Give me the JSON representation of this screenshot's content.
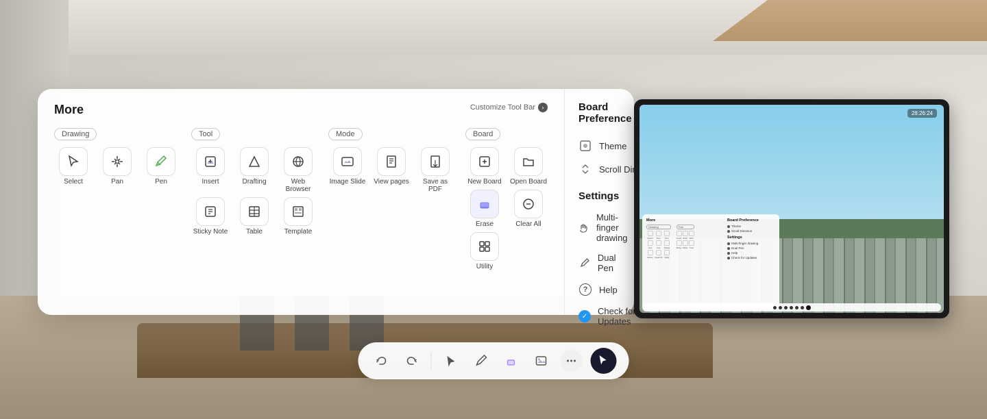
{
  "room": {
    "bg_description": "Office meeting room with whiteboard wall"
  },
  "modal": {
    "title": "More",
    "customize_bar_label": "Customize Tool Bar",
    "sections": {
      "drawing": {
        "label": "Drawing",
        "tools": [
          {
            "name": "Select",
            "icon": "cursor"
          },
          {
            "name": "Pan",
            "icon": "hand"
          },
          {
            "name": "Pen",
            "icon": "pen"
          }
        ]
      },
      "tool": {
        "label": "Tool",
        "tools": [
          {
            "name": "Insert",
            "icon": "image"
          },
          {
            "name": "Drafting",
            "icon": "triangle"
          },
          {
            "name": "Web Browser",
            "icon": "globe"
          },
          {
            "name": "Sticky Note",
            "icon": "sticky"
          },
          {
            "name": "Table",
            "icon": "table"
          },
          {
            "name": "Template",
            "icon": "template"
          }
        ]
      },
      "mode": {
        "label": "Mode",
        "tools": [
          {
            "name": "Image Slide",
            "icon": "image2"
          },
          {
            "name": "View pages",
            "icon": "book"
          },
          {
            "name": "Save as PDF",
            "icon": "save"
          }
        ]
      },
      "board": {
        "label": "Board",
        "tools": [
          {
            "name": "New Board",
            "icon": "newboard"
          },
          {
            "name": "Open Board",
            "icon": "openboard"
          },
          {
            "name": "Erase",
            "icon": "erase"
          },
          {
            "name": "Clear All",
            "icon": "clearall"
          },
          {
            "name": "Utility",
            "icon": "utility"
          }
        ]
      }
    }
  },
  "board_preference": {
    "title": "Board Preference",
    "items": [
      {
        "label": "Theme",
        "icon": "theme-icon"
      },
      {
        "label": "Scroll Direction",
        "icon": "scroll-icon"
      }
    ]
  },
  "settings": {
    "title": "Settings",
    "items": [
      {
        "label": "Multi-finger drawing",
        "icon": "finger-icon",
        "toggle": true,
        "toggle_state": "on"
      },
      {
        "label": "Dual Pen",
        "icon": "pen-icon",
        "toggle": true,
        "toggle_state": "off"
      },
      {
        "label": "Help",
        "icon": "help-icon",
        "toggle": false
      },
      {
        "label": "Check for Updates",
        "icon": "update-icon",
        "toggle": false
      }
    ]
  },
  "toolbar": {
    "buttons": [
      {
        "name": "undo",
        "icon": "↩",
        "label": "Undo"
      },
      {
        "name": "redo",
        "icon": "↪",
        "label": "Redo"
      },
      {
        "name": "select",
        "icon": "▷",
        "label": "Select"
      },
      {
        "name": "pen",
        "icon": "✏",
        "label": "Pen"
      },
      {
        "name": "eraser",
        "icon": "⬜",
        "label": "Eraser"
      },
      {
        "name": "image",
        "icon": "🖼",
        "label": "Image"
      },
      {
        "name": "more",
        "icon": "⋯",
        "label": "More"
      },
      {
        "name": "active",
        "icon": "◎",
        "label": "Active Tool"
      }
    ]
  },
  "tv": {
    "time": "28:26:24"
  }
}
